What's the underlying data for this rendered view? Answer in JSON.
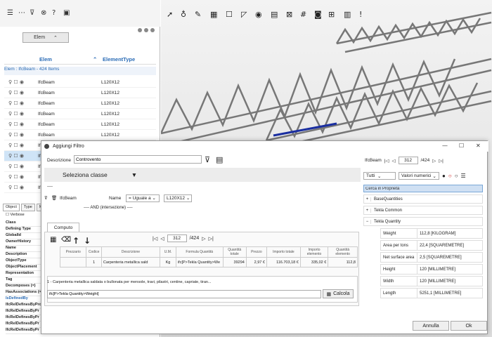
{
  "left": {
    "elem_button_label": "Elem",
    "grid_header": {
      "col1": "Elem",
      "col2": "ElementType"
    },
    "group_label": "Elem : IfcBeam - 424 Items",
    "rows": [
      {
        "name": "IfcBeam",
        "type": "L120X12"
      },
      {
        "name": "IfcBeam",
        "type": "L120X12"
      },
      {
        "name": "IfcBeam",
        "type": "L120X12"
      },
      {
        "name": "IfcBeam",
        "type": "L120X12"
      },
      {
        "name": "IfcBeam",
        "type": "L120X12"
      },
      {
        "name": "IfcBeam",
        "type": "L120X12"
      },
      {
        "name": "Ifc",
        "type": ""
      },
      {
        "name": "Ifc",
        "type": ""
      },
      {
        "name": "Ifc",
        "type": ""
      },
      {
        "name": "Ifc",
        "type": ""
      },
      {
        "name": "Ifc",
        "type": ""
      }
    ],
    "tabs": [
      "Object",
      "Type",
      "Mate"
    ],
    "verbose_label": "Verbose",
    "properties": [
      "Class",
      "Defining Type",
      "GlobalId",
      "OwnerHistory",
      "Name",
      "Description",
      "ObjectType",
      "ObjectPlacement",
      "Representation",
      "Tag",
      "Decomposes (=)",
      "HasAssociations (=)",
      "IsDefinedBy",
      "IfcRelDefinesByPro",
      "IfcRelDefinesByPr",
      "IfcRelDefinesByPr",
      "IfcRelDefinesByPr",
      "IfcRelDefinesByPr"
    ]
  },
  "dialog": {
    "title": "Aggiungi Filtro",
    "description_label": "Descrizione",
    "description_value": "Controvento",
    "class_select_label": "Seleziona classe",
    "dashes": "----",
    "filter": {
      "class": "IfcBeam",
      "prop": "Name",
      "operator": "= Uguale a",
      "value": "L120X12"
    },
    "and_label": "---- AND (intersezione) ----",
    "computo_tab": "Computo",
    "pager": {
      "current": "312",
      "total": "/424"
    },
    "table": {
      "headers": [
        "Prezzario",
        "Codice",
        "Descrizione",
        "U.M.",
        "Formula Quantità",
        "Quantità totale",
        "Prezzo",
        "Importo totale",
        "Importo elemento",
        "Quantità elemento"
      ],
      "row": [
        "",
        "1",
        "Carpenteria metallica sald",
        "Kg",
        "ifc[P>Tekla Quantity>We",
        "39294",
        "2,97 €",
        "116.703,18 €",
        "335,02 €",
        "112,8"
      ]
    },
    "note": "1 - Carpenteria metallica saldata o bullonata per mensole, travi, pilastri, centine, capriate, tiran...",
    "formula": "ifc[P>Tekla Quantity>Weight]",
    "calcola_label": "Calcola",
    "right": {
      "entity": "IfcBeam",
      "current": "312",
      "total": "/424",
      "tutti": "Tutti",
      "valori": "Valori numerici",
      "search_placeholder": "Cerca in Proprietà",
      "groups": [
        "BaseQuantities",
        "Tekla Common",
        "Tekla Quantity"
      ],
      "quantities": [
        {
          "name": "Weight",
          "value": "112,8 [KILOGRAM]"
        },
        {
          "name": "Area per tons",
          "value": "22,4 [SQUAREMETRE]"
        },
        {
          "name": "Net surface area",
          "value": "2,5 [SQUAREMETRE]"
        },
        {
          "name": "Height",
          "value": "120 [MILLIMETRE]"
        },
        {
          "name": "Width",
          "value": "120 [MILLIMETRE]"
        },
        {
          "name": "Length",
          "value": "5251,1 [MILLIMETRE]"
        }
      ]
    },
    "annulla_label": "Annulla",
    "ok_label": "Ok"
  }
}
